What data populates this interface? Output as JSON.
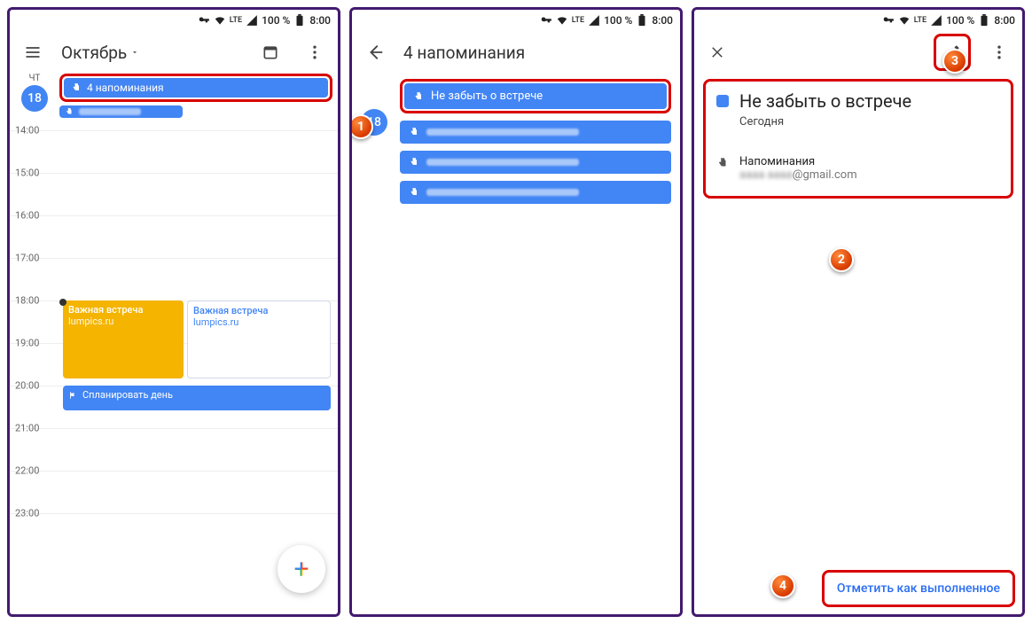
{
  "status": {
    "battery": "100 %",
    "time": "8:00",
    "network": "LTE"
  },
  "screen1": {
    "month": "Октябрь",
    "day_short": "ЧТ",
    "day_num": "18",
    "reminders_chip": "4 напоминания",
    "hours": [
      "14:00",
      "15:00",
      "16:00",
      "17:00",
      "18:00",
      "19:00",
      "20:00",
      "21:00",
      "22:00",
      "23:00"
    ],
    "ev_yellow_title": "Важная встреча",
    "ev_yellow_sub": "lumpics.ru",
    "ev_white_title": "Важная встреча",
    "ev_white_sub": "lumpics.ru",
    "ev_blue_title": "Спланировать день"
  },
  "screen2": {
    "title": "4 напоминания",
    "day_num": "18",
    "item1": "Не забыть о встрече"
  },
  "screen3": {
    "title": "Не забыть о встрече",
    "when": "Сегодня",
    "section": "Напоминания",
    "email_domain": "@gmail.com",
    "mark_done": "Отметить как выполненное"
  },
  "callouts": {
    "c1": "1",
    "c2": "2",
    "c3": "3",
    "c4": "4"
  }
}
